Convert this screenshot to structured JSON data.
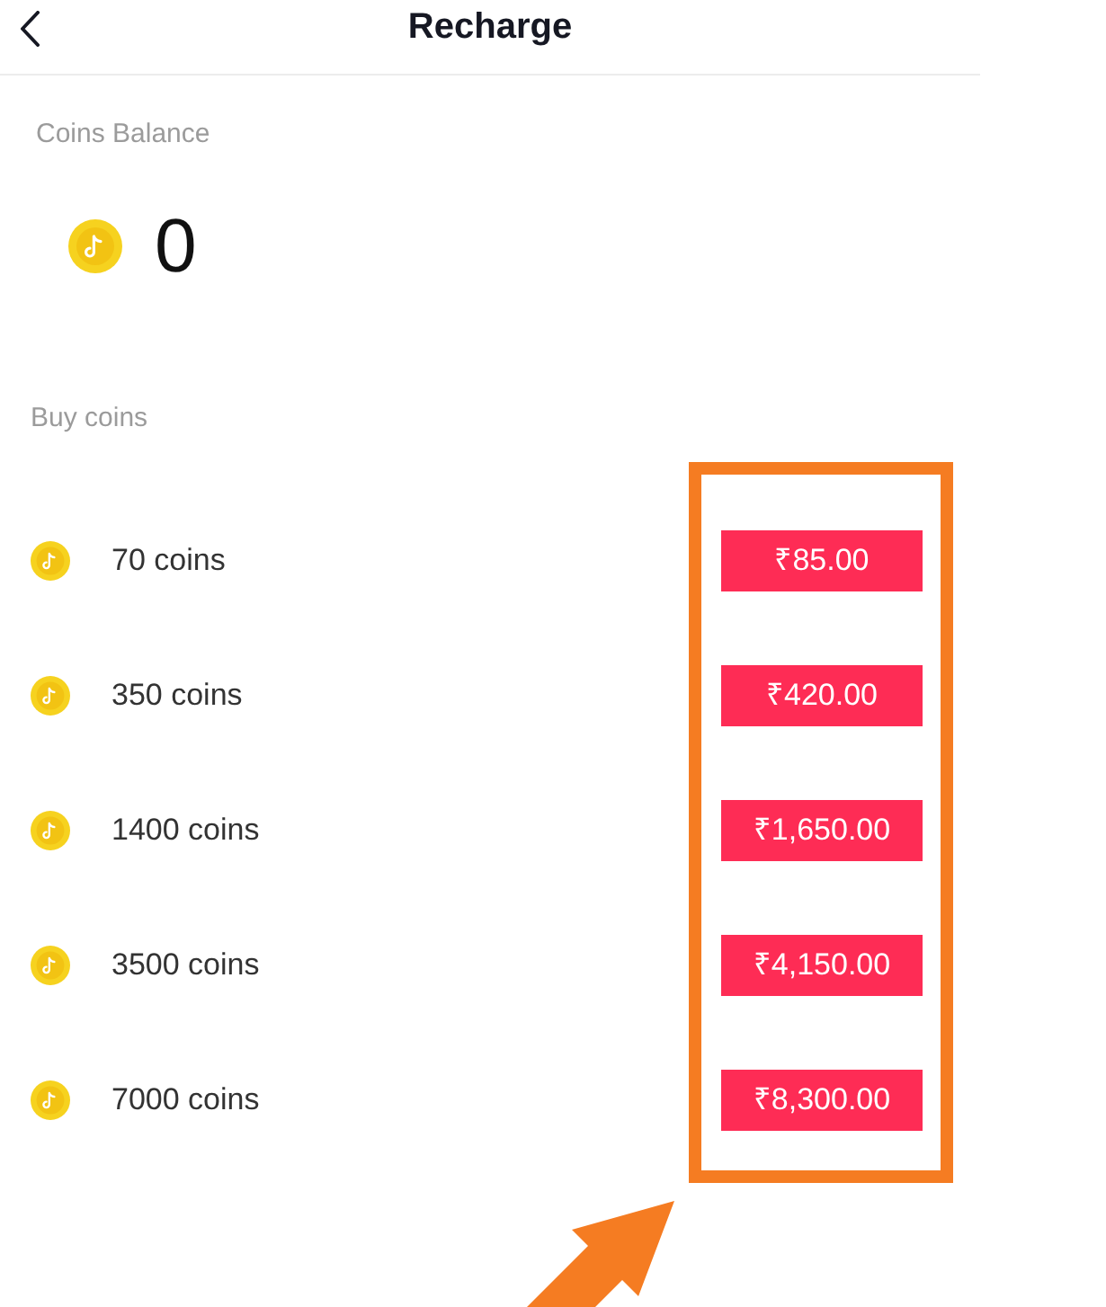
{
  "header": {
    "title": "Recharge"
  },
  "balance": {
    "label": "Coins Balance",
    "amount": "0"
  },
  "buy": {
    "heading": "Buy coins",
    "packages": [
      {
        "coins": "70 coins",
        "price": "₹85.00"
      },
      {
        "coins": "350 coins",
        "price": "₹420.00"
      },
      {
        "coins": "1400 coins",
        "price": "₹1,650.00"
      },
      {
        "coins": "3500 coins",
        "price": "₹4,150.00"
      },
      {
        "coins": "7000 coins",
        "price": "₹8,300.00"
      }
    ]
  }
}
